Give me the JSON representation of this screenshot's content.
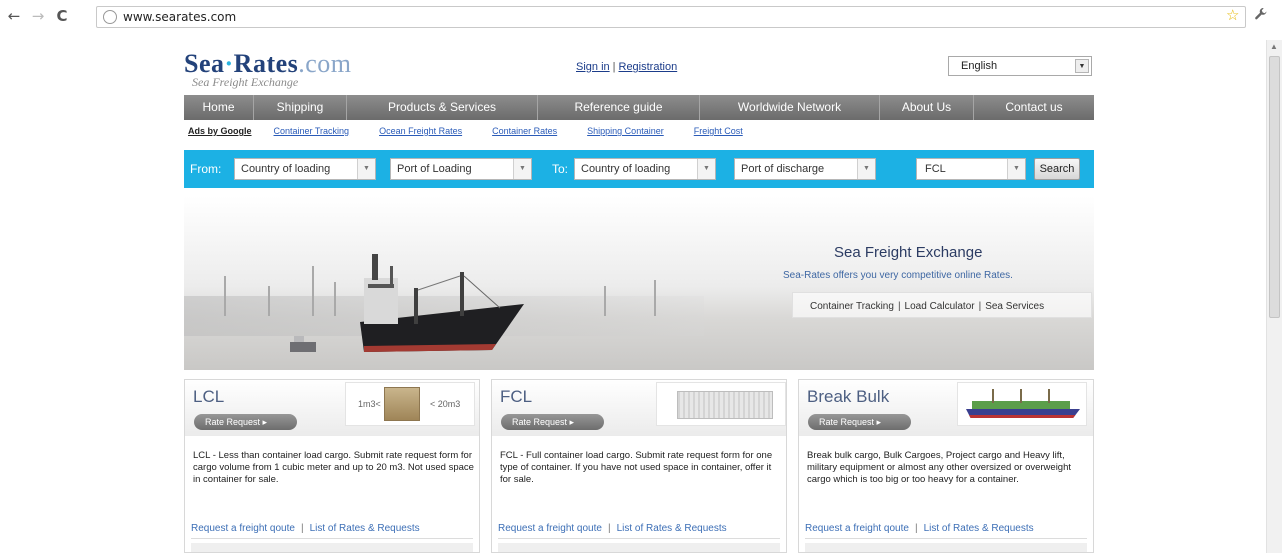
{
  "browser": {
    "url": "www.searates.com"
  },
  "header": {
    "logo_main": "Sea",
    "logo_dot": "·",
    "logo_name": "Rates",
    "logo_tld": ".com",
    "logo_sub": "Sea Freight Exchange",
    "sign_in": "Sign in",
    "separator": "|",
    "registration": "Registration",
    "language": "English"
  },
  "nav": {
    "items": [
      "Home",
      "Shipping",
      "Products & Services",
      "Reference guide",
      "Worldwide Network",
      "About Us",
      "Contact us"
    ]
  },
  "ads": {
    "label": "Ads by Google",
    "links": [
      "Container Tracking",
      "Ocean Freight Rates",
      "Container Rates",
      "Shipping Container",
      "Freight Cost"
    ]
  },
  "search": {
    "from_label": "From:",
    "to_label": "To:",
    "from_country": "Country of loading",
    "from_port": "Port of Loading",
    "to_country": "Country of loading",
    "to_port": "Port of discharge",
    "type": "FCL",
    "button": "Search"
  },
  "banner": {
    "title": "Sea Freight Exchange",
    "description": "Sea-Rates offers you very competitive online Rates.",
    "links": [
      "Container Tracking",
      "Load Calculator",
      "Sea Services"
    ]
  },
  "cards": [
    {
      "title": "LCL",
      "button": "Rate Request ▸",
      "image_left": "1m3<",
      "image_right": "< 20m3",
      "description": "LCL - Less than container load cargo. Submit rate request form for cargo volume from 1 cubic meter and up to 20 m3. Not used space in container for sale.",
      "link1": "Request a freight qoute",
      "link2": "List of Rates & Requests"
    },
    {
      "title": "FCL",
      "button": "Rate Request ▸",
      "description": "FCL - Full container load cargo. Submit rate request form for one type of container. If you have not used space in container, offer it for sale.",
      "link1": "Request a freight qoute",
      "link2": "List of Rates & Requests"
    },
    {
      "title": "Break Bulk",
      "button": "Rate Request ▸",
      "description": "Break bulk cargo, Bulk Cargoes, Project cargo and Heavy lift, military equipment or almost any other oversized or overweight cargo which is too big or too heavy for a container.",
      "link1": "Request a freight qoute",
      "link2": "List of Rates & Requests"
    }
  ],
  "icons": {
    "back": "←",
    "forward": "→",
    "reload": "C",
    "star": "☆",
    "wrench": "🔧"
  }
}
